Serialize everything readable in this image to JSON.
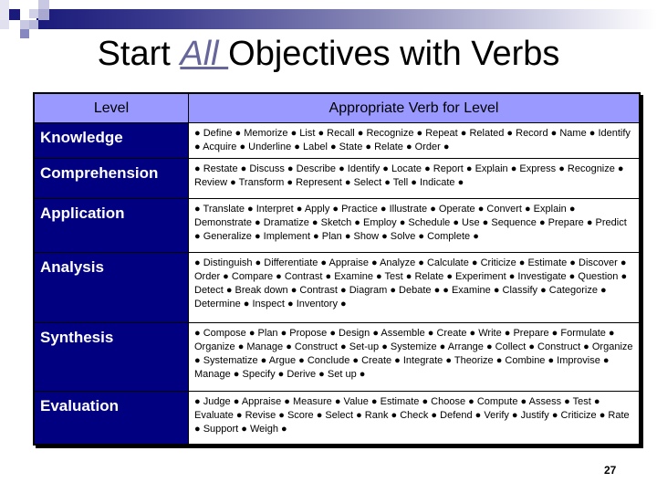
{
  "slide": {
    "title_prefix": "Start ",
    "title_emphasis": "All ",
    "title_suffix": "Objectives with Verbs",
    "page_number": "27"
  },
  "table": {
    "headers": [
      "Level",
      "Appropriate Verb  for Level"
    ],
    "rows": [
      {
        "level": "Knowledge",
        "verbs": "● Define ● Memorize ● List ● Recall ● Recognize ● Repeat ● Related ● Record ● Name ● Identify ● Acquire ● Underline ● Label ●  State ● Relate ● Order ●"
      },
      {
        "level": "Comprehension",
        "verbs": "● Restate ● Discuss ● Describe ● Identify ● Locate ● Report ● Explain ● Express ● Recognize ● Review ● Transform ● Represent ● Select ● Tell ● Indicate ●"
      },
      {
        "level": "Application",
        "verbs": "● Translate ● Interpret ● Apply ● Practice ● Illustrate ● Operate ● Convert ●  Explain ● Demonstrate ● Dramatize ● Sketch ● Employ ● Schedule ● Use ● Sequence ● Prepare ● Predict ● Generalize ● Implement ● Plan ● Show ● Solve ● Complete ●"
      },
      {
        "level": "Analysis",
        "verbs": "● Distinguish ● Differentiate ● Appraise ● Analyze ● Calculate ● Criticize ● Estimate ●  Discover ● Order ● Compare ● Contrast ● Examine ● Test ● Relate ● Experiment ●  Investigate  ●  Question ● Detect ● Break down ● Contrast ● Diagram ● Debate ● ● Examine ● Classify ● Categorize ● Determine ● Inspect ● Inventory ●"
      },
      {
        "level": "Synthesis",
        "verbs": "● Compose ● Plan ● Propose ● Design ● Assemble ● Create ● Write ● Prepare ● Formulate ● Organize ● Manage ● Construct ● Set-up ● Systemize ● Arrange ● Collect ● Construct ● Organize ● Systematize ● Argue ● Conclude ● Create ● Integrate ● Theorize ● Combine ● Improvise ● Manage ● Specify ● Derive ● Set up ●"
      },
      {
        "level": "Evaluation",
        "verbs": "● Judge ● Appraise ● Measure ● Value ● Estimate ● Choose ● Compute ● Assess ● Test ● Evaluate ● Revise ● Score ● Select ● Rank ● Check ● Defend ● Verify ● Justify ● Criticize ● Rate ● Support ● Weigh ●"
      }
    ]
  },
  "colors": {
    "header_bg": "#9999ff",
    "level_bg": "#000080",
    "title_accent": "#66669a"
  }
}
